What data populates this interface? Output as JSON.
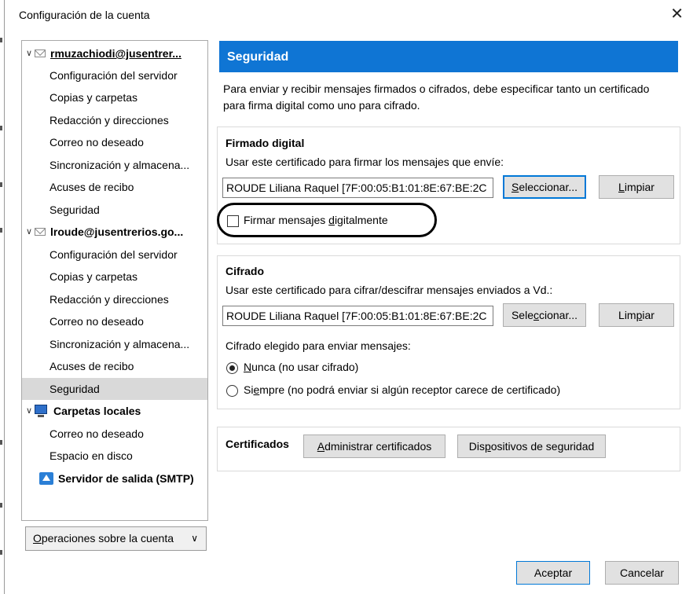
{
  "window": {
    "title": "Configuración de la cuenta",
    "close_glyph": "✕"
  },
  "tree": {
    "rows": [
      {
        "label": "rmuzachiodi@jusentrer...",
        "kind": "account"
      },
      {
        "label": "Configuración del servidor",
        "kind": "item"
      },
      {
        "label": "Copias y carpetas",
        "kind": "item"
      },
      {
        "label": "Redacción y direcciones",
        "kind": "item"
      },
      {
        "label": "Correo no deseado",
        "kind": "item"
      },
      {
        "label": "Sincronización y almacena...",
        "kind": "item"
      },
      {
        "label": "Acuses de recibo",
        "kind": "item"
      },
      {
        "label": "Seguridad",
        "kind": "item"
      },
      {
        "label": "lroude@jusentrerios.go...",
        "kind": "account2"
      },
      {
        "label": "Configuración del servidor",
        "kind": "item"
      },
      {
        "label": "Copias y carpetas",
        "kind": "item"
      },
      {
        "label": "Redacción y direcciones",
        "kind": "item"
      },
      {
        "label": "Correo no deseado",
        "kind": "item"
      },
      {
        "label": "Sincronización y almacena...",
        "kind": "item"
      },
      {
        "label": "Acuses de recibo",
        "kind": "item"
      },
      {
        "label": "Seguridad",
        "kind": "selected"
      },
      {
        "label": "Carpetas locales",
        "kind": "local"
      },
      {
        "label": "Correo no deseado",
        "kind": "item"
      },
      {
        "label": "Espacio en disco",
        "kind": "item"
      },
      {
        "label": "Servidor de salida (SMTP)",
        "kind": "smtp"
      }
    ],
    "account_ops": {
      "label_underlined": "O",
      "label_rest": "peraciones sobre la cuenta",
      "chevron": "⌄"
    }
  },
  "security": {
    "header": "Seguridad",
    "intro": "Para enviar y recibir mensajes firmados o cifrados, debe especificar tanto un certificado para firma digital como uno para cifrado.",
    "signing": {
      "title": "Firmado digital",
      "description": "Usar este certificado para firmar los mensajes que envíe:",
      "certificate": "ROUDE Liliana Raquel [7F:00:05:B1:01:8E:67:BE:2C",
      "select_pre": "",
      "select_u": "S",
      "select_post": "eleccionar...",
      "clear_pre": "",
      "clear_u": "L",
      "clear_post": "impiar",
      "checkbox_pre": "Firmar mensajes ",
      "checkbox_u": "d",
      "checkbox_post": "igitalmente",
      "checkbox_checked": false
    },
    "encryption": {
      "title": "Cifrado",
      "description": "Usar este certificado para cifrar/descifrar mensajes enviados a Vd.:",
      "certificate": "ROUDE Liliana Raquel [7F:00:05:B1:01:8E:67:BE:2C",
      "select_pre": "Sele",
      "select_u": "c",
      "select_post": "cionar...",
      "clear_pre": "Lim",
      "clear_u": "p",
      "clear_post": "iar",
      "mode_label": "Cifrado elegido para enviar mensajes:",
      "never_u": "N",
      "never_rest": "unca (no usar cifrado)",
      "always_pre": "Si",
      "always_u": "e",
      "always_post": "mpre (no podrá enviar si algún receptor carece de certificado)",
      "selected": "never"
    },
    "certificates": {
      "title": "Certificados",
      "manage_u": "A",
      "manage_rest": "dministrar certificados",
      "devices_pre": "Dis",
      "devices_u": "p",
      "devices_post": "ositivos de seguridad"
    }
  },
  "footer": {
    "ok": "Aceptar",
    "cancel": "Cancelar"
  }
}
